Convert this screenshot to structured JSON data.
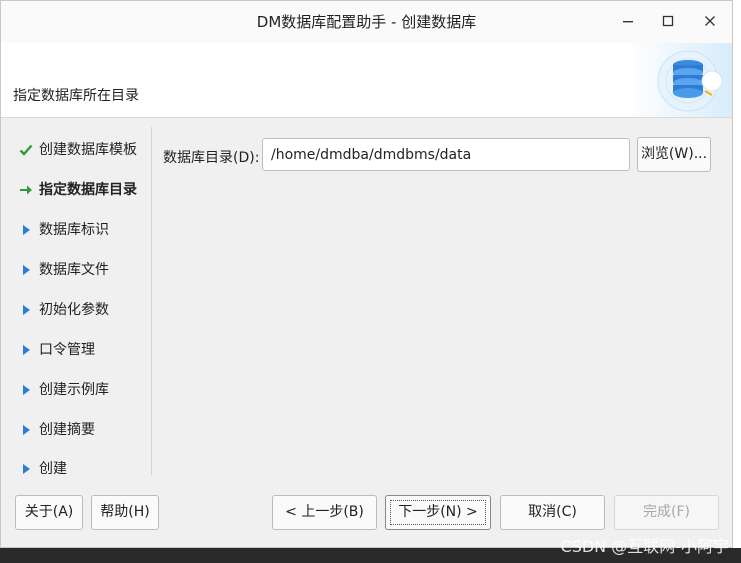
{
  "window": {
    "title": "DM数据库配置助手 - 创建数据库",
    "minimize_glyph": "—",
    "maximize_glyph": "☐",
    "close_glyph": "✕"
  },
  "header": {
    "subtitle": "指定数据库所在目录",
    "logo_icon": "database-icon"
  },
  "steps": [
    {
      "label": "创建数据库模板",
      "state": "done",
      "icon": "checkmark-icon"
    },
    {
      "label": "指定数据库目录",
      "state": "current",
      "icon": "arrow-right-icon"
    },
    {
      "label": "数据库标识",
      "state": "pending",
      "icon": "triangle-right-icon"
    },
    {
      "label": "数据库文件",
      "state": "pending",
      "icon": "triangle-right-icon"
    },
    {
      "label": "初始化参数",
      "state": "pending",
      "icon": "triangle-right-icon"
    },
    {
      "label": "口令管理",
      "state": "pending",
      "icon": "triangle-right-icon"
    },
    {
      "label": "创建示例库",
      "state": "pending",
      "icon": "triangle-right-icon"
    },
    {
      "label": "创建摘要",
      "state": "pending",
      "icon": "triangle-right-icon"
    },
    {
      "label": "创建",
      "state": "pending",
      "icon": "triangle-right-icon"
    }
  ],
  "content": {
    "dir_label": "数据库目录(D):",
    "dir_value": "/home/dmdba/dmdbms/data",
    "browse_label": "浏览(W)..."
  },
  "footer": {
    "about": "关于(A)",
    "help": "帮助(H)",
    "prev": "< 上一步(B)",
    "next": "下一步(N) >",
    "cancel": "取消(C)",
    "finish": "完成(F)"
  },
  "watermark": "CSDN @互联网-小阿宇",
  "colors": {
    "done_check": "#2e9b3a",
    "current_arrow": "#2e9b3a",
    "pending_triangle": "#2f7bd6"
  }
}
